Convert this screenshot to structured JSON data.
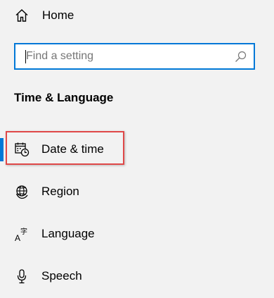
{
  "home": {
    "label": "Home",
    "icon": "home-icon"
  },
  "search": {
    "placeholder": "Find a setting",
    "value": "",
    "icon": "search-icon",
    "border_color": "#0078d7"
  },
  "section": {
    "title": "Time & Language"
  },
  "nav": {
    "items": [
      {
        "label": "Date & time",
        "icon": "calendar-clock-icon",
        "selected": true
      },
      {
        "label": "Region",
        "icon": "globe-icon",
        "selected": false
      },
      {
        "label": "Language",
        "icon": "language-icon",
        "selected": false
      },
      {
        "label": "Speech",
        "icon": "microphone-icon",
        "selected": false
      }
    ]
  },
  "colors": {
    "accent": "#0078d7",
    "highlight_border": "#e04848",
    "background": "#f2f2f2"
  }
}
